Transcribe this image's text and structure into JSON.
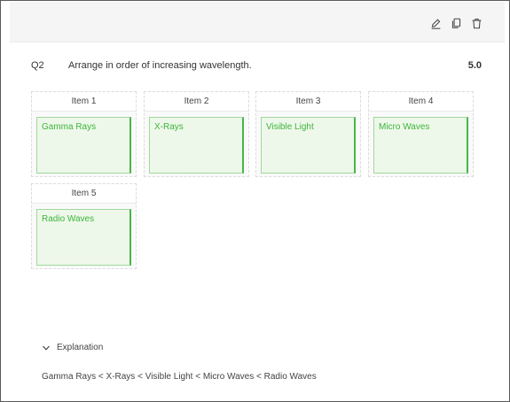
{
  "toolbar": {
    "icons": [
      "edit-icon",
      "copy-icon",
      "trash-icon"
    ]
  },
  "question": {
    "number": "Q2",
    "text": "Arrange in order of increasing wavelength.",
    "score": "5.0"
  },
  "items": [
    {
      "label": "Item 1",
      "answer": "Gamma Rays"
    },
    {
      "label": "Item 2",
      "answer": "X-Rays"
    },
    {
      "label": "Item 3",
      "answer": "Visible Light"
    },
    {
      "label": "Item 4",
      "answer": "Micro Waves"
    },
    {
      "label": "Item 5",
      "answer": "Radio Waves"
    }
  ],
  "explanation": {
    "toggle_label": "Explanation",
    "text": "Gamma Rays < X-Rays < Visible Light < Micro Waves < Radio Waves"
  },
  "colors": {
    "answer_text": "#3cb53c",
    "answer_bg": "#eef8ea",
    "answer_border": "#48b548"
  }
}
